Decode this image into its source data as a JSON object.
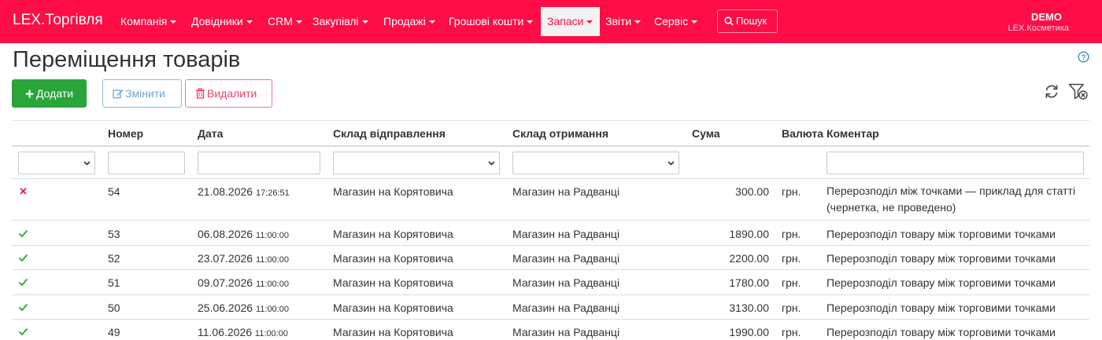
{
  "app": {
    "brand": "LEX.Торгівля"
  },
  "nav": [
    {
      "label": "Компанія",
      "active": false
    },
    {
      "label": "Довідники",
      "active": false
    },
    {
      "label": "CRM",
      "active": false
    },
    {
      "label": "Закупівлі",
      "active": false
    },
    {
      "label": "Продажі",
      "active": false
    },
    {
      "label": "Грошові кошти",
      "active": false
    },
    {
      "label": "Запаси",
      "active": true
    },
    {
      "label": "Звіти",
      "active": false
    },
    {
      "label": "Сервіс",
      "active": false
    }
  ],
  "search": {
    "label": "Пошук"
  },
  "user": {
    "name": "DEMO",
    "company": "LEX.Косметика"
  },
  "page": {
    "title": "Переміщення товарів"
  },
  "toolbar": {
    "add_label": "Додати",
    "edit_label": "Змінити",
    "delete_label": "Видалити"
  },
  "colors": {
    "brand": "#fe0d46",
    "add": "#2aa53a",
    "edit": "#6ea7cf",
    "delete": "#ea3f66",
    "ok": "#2aa53a",
    "draft": "#e0183f"
  },
  "table": {
    "columns": {
      "number": "Номер",
      "date": "Дата",
      "from": "Склад відправлення",
      "to": "Склад отримання",
      "sum": "Сума",
      "currency": "Валюта",
      "comment": "Коментар"
    },
    "rows": [
      {
        "status": "draft",
        "number": "54",
        "date": "21.08.2026",
        "time": "17:26:51",
        "from": "Магазин на Корятовича",
        "to": "Магазин на Радванці",
        "sum": "300.00",
        "currency": "грн.",
        "comment": "Перерозподіл між точками — приклад для статті (чернетка, не проведено)"
      },
      {
        "status": "ok",
        "number": "53",
        "date": "06.08.2026",
        "time": "11:00:00",
        "from": "Магазин на Корятовича",
        "to": "Магазин на Радванці",
        "sum": "1890.00",
        "currency": "грн.",
        "comment": "Перерозподіл товару між торговими точками"
      },
      {
        "status": "ok",
        "number": "52",
        "date": "23.07.2026",
        "time": "11:00:00",
        "from": "Магазин на Корятовича",
        "to": "Магазин на Радванці",
        "sum": "2200.00",
        "currency": "грн.",
        "comment": "Перерозподіл товару між торговими точками"
      },
      {
        "status": "ok",
        "number": "51",
        "date": "09.07.2026",
        "time": "11:00:00",
        "from": "Магазин на Корятовича",
        "to": "Магазин на Радванці",
        "sum": "1780.00",
        "currency": "грн.",
        "comment": "Перерозподіл товару між торговими точками"
      },
      {
        "status": "ok",
        "number": "50",
        "date": "25.06.2026",
        "time": "11:00:00",
        "from": "Магазин на Корятовича",
        "to": "Магазин на Радванці",
        "sum": "3130.00",
        "currency": "грн.",
        "comment": "Перерозподіл товару між торговими точками"
      },
      {
        "status": "ok",
        "number": "49",
        "date": "11.06.2026",
        "time": "11:00:00",
        "from": "Магазин на Корятовича",
        "to": "Магазин на Радванці",
        "sum": "1990.00",
        "currency": "грн.",
        "comment": "Перерозподіл товару між торговими точками"
      }
    ]
  }
}
